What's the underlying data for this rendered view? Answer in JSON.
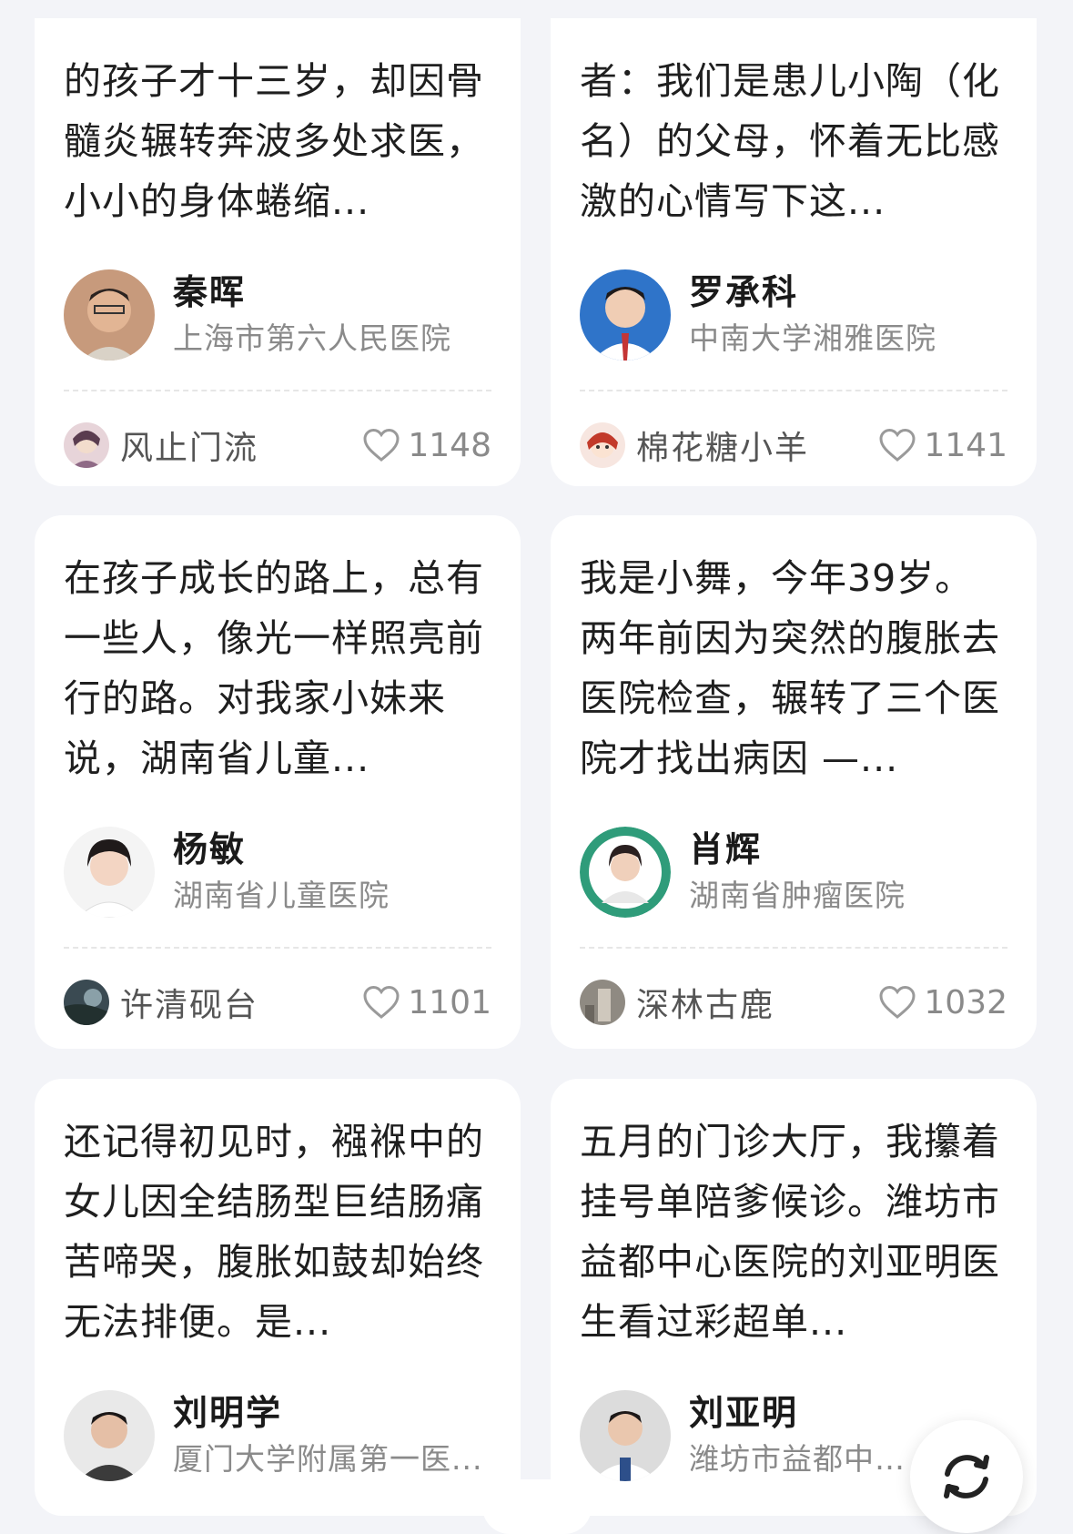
{
  "cards": [
    {
      "story": "的孩子才十三岁，却因骨髓炎辗转奔波多处求医，小小的身体蜷缩...",
      "doctor_name": "秦晖",
      "hospital": "上海市第六人民医院",
      "user_name": "风止门流",
      "likes": "1148"
    },
    {
      "story": "者：我们是患儿小陶（化名）的父母，怀着无比感激的心情写下这...",
      "doctor_name": "罗承科",
      "hospital": "中南大学湘雅医院",
      "user_name": "棉花糖小羊",
      "likes": "1141"
    },
    {
      "story": "在孩子成长的路上，总有一些人，像光一样照亮前行的路。对我家小妹来说，湖南省儿童...",
      "doctor_name": "杨敏",
      "hospital": "湖南省儿童医院",
      "user_name": "许清砚台",
      "likes": "1101"
    },
    {
      "story": "我是小舞，今年39岁。两年前因为突然的腹胀去医院检查，辗转了三个医院才找出病因 —...",
      "doctor_name": "肖辉",
      "hospital": "湖南省肿瘤医院",
      "user_name": "深林古鹿",
      "likes": "1032"
    },
    {
      "story": "还记得初见时，襁褓中的女儿因全结肠型巨结肠痛苦啼哭，腹胀如鼓却始终无法排便。是...",
      "doctor_name": "刘明学",
      "hospital": "厦门大学附属第一医...",
      "user_name": "",
      "likes": ""
    },
    {
      "story": "五月的门诊大厅，我攥着挂号单陪爹候诊。潍坊市益都中心医院的刘亚明医生看过彩超单...",
      "doctor_name": "刘亚明",
      "hospital": "潍坊市益都中心医院",
      "user_name": "",
      "likes": ""
    }
  ],
  "colors": {
    "background": "#f3f4f8",
    "card": "#ffffff",
    "text_primary": "#1f1f1f",
    "text_secondary": "#8a8a8a"
  },
  "icons": {
    "like": "heart-outline-icon",
    "refresh": "refresh-icon"
  }
}
